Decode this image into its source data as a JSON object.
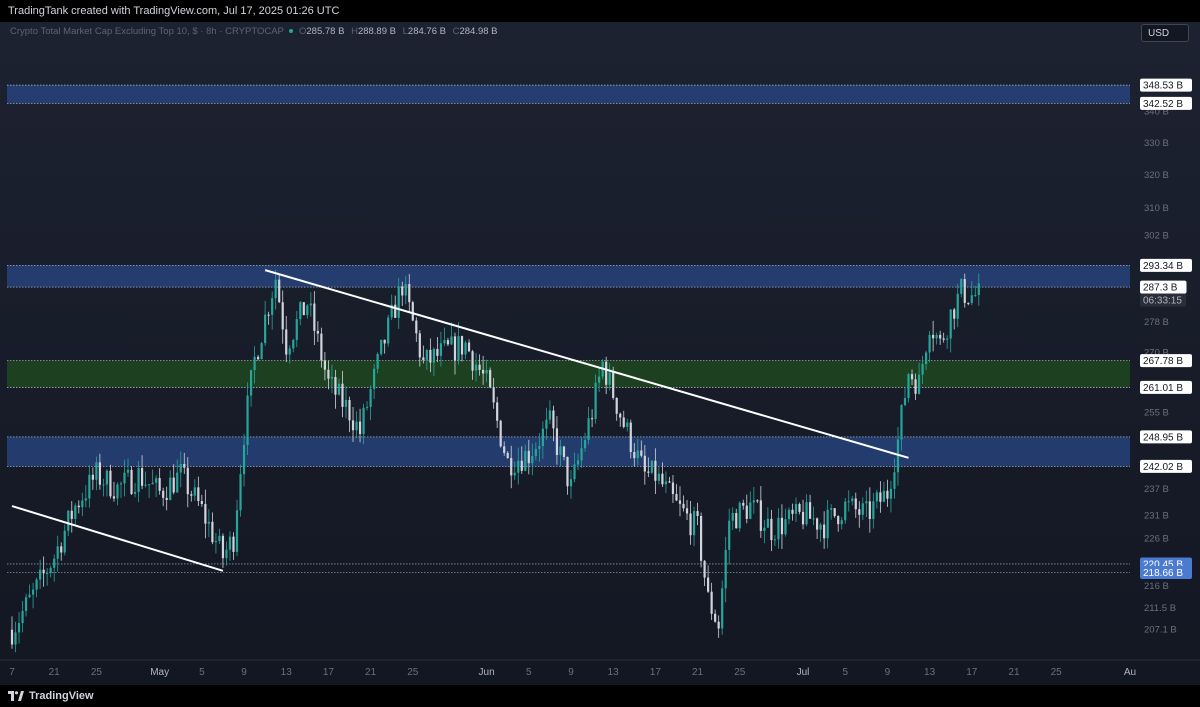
{
  "header": {
    "credit": "TradingTank created with TradingView.com, Jul 17, 2025 01:26 UTC"
  },
  "legend": {
    "symbol": "Crypto Total Market Cap Excluding Top 10, $ · 8h · CRYPTOCAP",
    "ohlc": [
      {
        "key": "O",
        "value": "285.78 B"
      },
      {
        "key": "H",
        "value": "288.89 B"
      },
      {
        "key": "L",
        "value": "284.76 B"
      },
      {
        "key": "C",
        "value": "284.98 B"
      }
    ]
  },
  "currency_button": "USD",
  "footer": {
    "logo_text": "TradingView"
  },
  "colors": {
    "background": "#131722",
    "up": "#26a69a",
    "down": "#d1d4dc",
    "zone_blue": "#2a4a8c",
    "zone_green": "#1e4620",
    "trendline": "#ffffff",
    "label_highlight": "#4a7bd0"
  },
  "chart_data": {
    "type": "candlestick",
    "title": "Crypto Total Market Cap Excluding Top 10, $ · 8h · CRYPTOCAP",
    "interval": "8h",
    "y_unit": "B USD",
    "y_scale": "log",
    "ylim": [
      204,
      356
    ],
    "x_range": [
      "2025-04-17",
      "2025-08-01"
    ],
    "last_price": 287.3,
    "countdown": "06:33:15",
    "price_ticks": [
      {
        "value": 340,
        "label": "340 B"
      },
      {
        "value": 330,
        "label": "330 B"
      },
      {
        "value": 320,
        "label": "320 B"
      },
      {
        "value": 310,
        "label": "310 B"
      },
      {
        "value": 302,
        "label": "302 B"
      },
      {
        "value": 278,
        "label": "278 B"
      },
      {
        "value": 270,
        "label": "270 B"
      },
      {
        "value": 255,
        "label": "255 B"
      },
      {
        "value": 237,
        "label": "237 B"
      },
      {
        "value": 231,
        "label": "231 B"
      },
      {
        "value": 226,
        "label": "226 B"
      },
      {
        "value": 216,
        "label": "216 B"
      },
      {
        "value": 211.5,
        "label": "211.5 B"
      },
      {
        "value": 207.1,
        "label": "207.1 B"
      }
    ],
    "level_labels": [
      {
        "value": 348.53,
        "label": "348.53 B",
        "style": "default"
      },
      {
        "value": 342.52,
        "label": "342.52 B",
        "style": "default"
      },
      {
        "value": 293.34,
        "label": "293.34 B",
        "style": "default"
      },
      {
        "value": 287.3,
        "label": "287.3 B",
        "style": "default"
      },
      {
        "value": 267.78,
        "label": "267.78 B",
        "style": "default"
      },
      {
        "value": 261.01,
        "label": "261.01 B",
        "style": "default"
      },
      {
        "value": 248.95,
        "label": "248.95 B",
        "style": "default"
      },
      {
        "value": 242.02,
        "label": "242.02 B",
        "style": "default"
      },
      {
        "value": 220.45,
        "label": "220.45 B",
        "style": "highlight"
      },
      {
        "value": 218.66,
        "label": "218.66 B",
        "style": "highlight"
      }
    ],
    "zones": [
      {
        "name": "resistance-zone-top",
        "from": 342.52,
        "to": 348.53,
        "color": "blue"
      },
      {
        "name": "resistance-zone-upper",
        "from": 287.3,
        "to": 293.34,
        "color": "blue"
      },
      {
        "name": "support-zone-green",
        "from": 261.01,
        "to": 267.78,
        "color": "green"
      },
      {
        "name": "support-zone-blue",
        "from": 242.02,
        "to": 248.95,
        "color": "blue"
      }
    ],
    "dotted_levels": [
      220.45,
      218.66
    ],
    "trendlines": [
      {
        "name": "trendline-lower",
        "from": {
          "date": "2025-04-17",
          "value": 233
        },
        "to": {
          "date": "2025-05-07",
          "value": 219
        }
      },
      {
        "name": "trendline-upper",
        "from": {
          "date": "2025-05-11",
          "value": 292
        },
        "to": {
          "date": "2025-07-11",
          "value": 244
        }
      }
    ],
    "x_ticks": [
      {
        "date": "2025-04-17",
        "label": "7"
      },
      {
        "date": "2025-04-21",
        "label": "21"
      },
      {
        "date": "2025-04-25",
        "label": "25"
      },
      {
        "date": "2025-05-01",
        "label": "May"
      },
      {
        "date": "2025-05-05",
        "label": "5"
      },
      {
        "date": "2025-05-09",
        "label": "9"
      },
      {
        "date": "2025-05-13",
        "label": "13"
      },
      {
        "date": "2025-05-17",
        "label": "17"
      },
      {
        "date": "2025-05-21",
        "label": "21"
      },
      {
        "date": "2025-05-25",
        "label": "25"
      },
      {
        "date": "2025-06-01",
        "label": "Jun"
      },
      {
        "date": "2025-06-05",
        "label": "5"
      },
      {
        "date": "2025-06-09",
        "label": "9"
      },
      {
        "date": "2025-06-13",
        "label": "13"
      },
      {
        "date": "2025-06-17",
        "label": "17"
      },
      {
        "date": "2025-06-21",
        "label": "21"
      },
      {
        "date": "2025-06-25",
        "label": "25"
      },
      {
        "date": "2025-07-01",
        "label": "Jul"
      },
      {
        "date": "2025-07-05",
        "label": "5"
      },
      {
        "date": "2025-07-09",
        "label": "9"
      },
      {
        "date": "2025-07-13",
        "label": "13"
      },
      {
        "date": "2025-07-17",
        "label": "17"
      },
      {
        "date": "2025-07-21",
        "label": "21"
      },
      {
        "date": "2025-07-25",
        "label": "25"
      },
      {
        "date": "2025-08-01",
        "label": "Au"
      }
    ],
    "price_path_approx": [
      {
        "date": "2025-04-17",
        "close": 207
      },
      {
        "date": "2025-04-19",
        "close": 214
      },
      {
        "date": "2025-04-21",
        "close": 222
      },
      {
        "date": "2025-04-23",
        "close": 233
      },
      {
        "date": "2025-04-25",
        "close": 240
      },
      {
        "date": "2025-04-27",
        "close": 237
      },
      {
        "date": "2025-04-29",
        "close": 240
      },
      {
        "date": "2025-05-01",
        "close": 236
      },
      {
        "date": "2025-05-03",
        "close": 240
      },
      {
        "date": "2025-05-05",
        "close": 232
      },
      {
        "date": "2025-05-07",
        "close": 222
      },
      {
        "date": "2025-05-08",
        "close": 226
      },
      {
        "date": "2025-05-09",
        "close": 250
      },
      {
        "date": "2025-05-10",
        "close": 268
      },
      {
        "date": "2025-05-12",
        "close": 290
      },
      {
        "date": "2025-05-13",
        "close": 272
      },
      {
        "date": "2025-05-15",
        "close": 283
      },
      {
        "date": "2025-05-17",
        "close": 262
      },
      {
        "date": "2025-05-19",
        "close": 255
      },
      {
        "date": "2025-05-20",
        "close": 250
      },
      {
        "date": "2025-05-22",
        "close": 270
      },
      {
        "date": "2025-05-24",
        "close": 288
      },
      {
        "date": "2025-05-26",
        "close": 267
      },
      {
        "date": "2025-05-28",
        "close": 270
      },
      {
        "date": "2025-05-30",
        "close": 272
      },
      {
        "date": "2025-06-01",
        "close": 262
      },
      {
        "date": "2025-06-03",
        "close": 243
      },
      {
        "date": "2025-06-05",
        "close": 245
      },
      {
        "date": "2025-06-07",
        "close": 252
      },
      {
        "date": "2025-06-09",
        "close": 237
      },
      {
        "date": "2025-06-11",
        "close": 255
      },
      {
        "date": "2025-06-12",
        "close": 267
      },
      {
        "date": "2025-06-14",
        "close": 252
      },
      {
        "date": "2025-06-16",
        "close": 240
      },
      {
        "date": "2025-06-17",
        "close": 240
      },
      {
        "date": "2025-06-19",
        "close": 233
      },
      {
        "date": "2025-06-21",
        "close": 228
      },
      {
        "date": "2025-06-22",
        "close": 213
      },
      {
        "date": "2025-06-23",
        "close": 208
      },
      {
        "date": "2025-06-24",
        "close": 230
      },
      {
        "date": "2025-06-26",
        "close": 233
      },
      {
        "date": "2025-06-28",
        "close": 228
      },
      {
        "date": "2025-07-01",
        "close": 231
      },
      {
        "date": "2025-07-03",
        "close": 229
      },
      {
        "date": "2025-07-05",
        "close": 233
      },
      {
        "date": "2025-07-07",
        "close": 231
      },
      {
        "date": "2025-07-09",
        "close": 236
      },
      {
        "date": "2025-07-10",
        "close": 248
      },
      {
        "date": "2025-07-11",
        "close": 265
      },
      {
        "date": "2025-07-12",
        "close": 262
      },
      {
        "date": "2025-07-13",
        "close": 278
      },
      {
        "date": "2025-07-14",
        "close": 272
      },
      {
        "date": "2025-07-15",
        "close": 280
      },
      {
        "date": "2025-07-16",
        "close": 286
      },
      {
        "date": "2025-07-17",
        "close": 285
      }
    ]
  }
}
